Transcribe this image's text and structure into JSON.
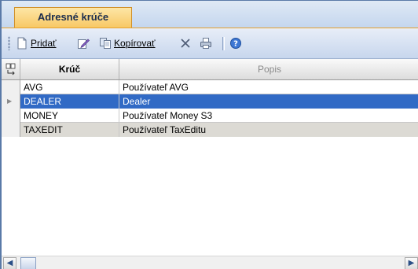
{
  "tab": {
    "label": "Adresné krúče"
  },
  "toolbar": {
    "add_label": "Pridať",
    "copy_label": "Kopírovať"
  },
  "grid": {
    "columns": [
      "Krúč",
      "Popis"
    ],
    "rows": [
      {
        "key": "AVG",
        "desc": "Používateľ AVG",
        "selected": false
      },
      {
        "key": "DEALER",
        "desc": "Dealer",
        "selected": true
      },
      {
        "key": "MONEY",
        "desc": "Používateľ Money S3",
        "selected": false
      },
      {
        "key": "TAXEDIT",
        "desc": "Používateľ TaxEditu",
        "selected": false
      }
    ]
  },
  "colors": {
    "selection": "#316ac5",
    "tab_accent": "#f8c865",
    "chrome": "#c7d6ed"
  },
  "icons": [
    "new-document-icon",
    "edit-icon",
    "copy-icon",
    "delete-icon",
    "print-icon",
    "help-icon",
    "column-chooser-icon",
    "row-pointer-icon"
  ]
}
